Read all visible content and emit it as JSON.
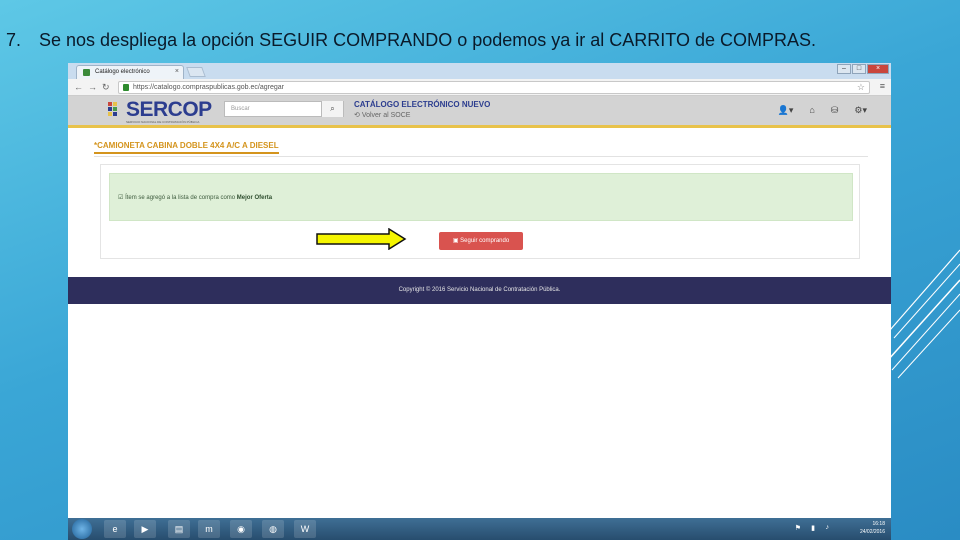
{
  "slide": {
    "number": "7.",
    "title": "Se nos despliega la opción SEGUIR COMPRANDO o podemos ya ir al CARRITO de COMPRAS."
  },
  "browser": {
    "tab_title": "Catálogo electrónico",
    "tab_close": "×",
    "url": "https://catalogo.compraspublicas.gob.ec/agregar",
    "window_buttons": [
      "–",
      "□",
      "×"
    ]
  },
  "site": {
    "logo_text": "SERCOP",
    "logo_tagline": "SERVICIO NACIONAL DE CONTRATACIÓN PÚBLICA",
    "search_placeholder": "Buscar",
    "catalog_title": "CATÁLOGO ELECTRÓNICO NUEVO",
    "catalog_link": "Volver al SOCE"
  },
  "content": {
    "product_title": "*CAMIONETA CABINA DOBLE 4X4 A/C A DIESEL",
    "alert_prefix": "Ítem se agregó a la lista de compra como",
    "alert_bold": "Mejor Oferta",
    "button_label": "Seguir comprando"
  },
  "footer": {
    "text": "Copyright © 2016 Servicio Nacional de Contratación Pública."
  },
  "taskbar": {
    "time": "16:18",
    "date": "24/02/2016"
  },
  "colors": {
    "slide_bg": "#3aa6d6",
    "header_accent": "#e8c24a",
    "product_title": "#d4941d",
    "alert_bg": "#dff0d8",
    "button": "#d9534f",
    "footer_bg": "#2e2e5c",
    "arrow_fill": "#f5f500"
  }
}
